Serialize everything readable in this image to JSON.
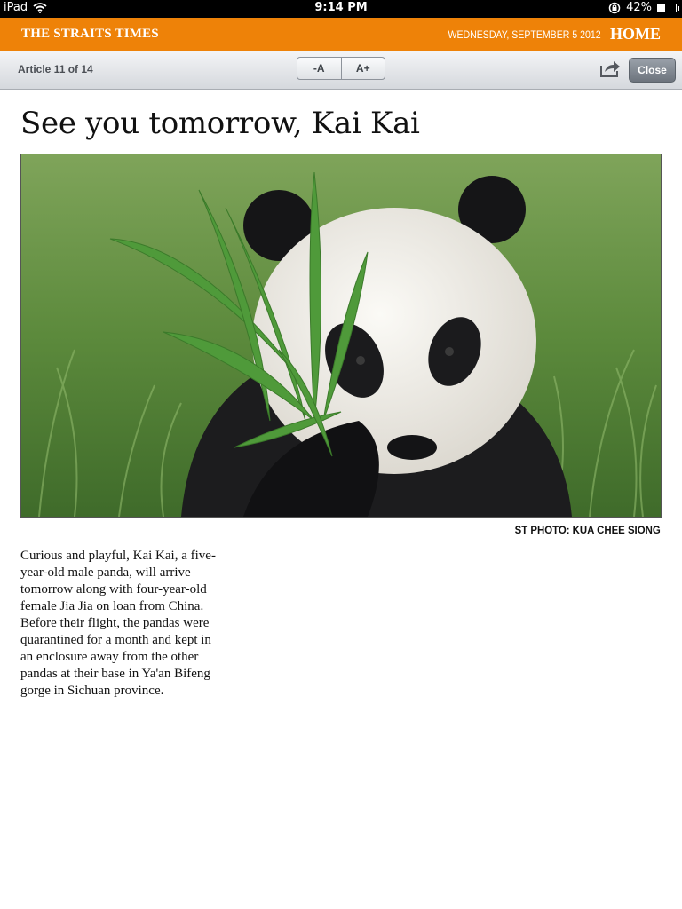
{
  "status_bar": {
    "device": "iPad",
    "time": "9:14 PM",
    "battery": "42%",
    "battery_level": 0.42
  },
  "masthead": {
    "brand": "THE STRAITS TIMES",
    "date": "WEDNESDAY, SEPTEMBER 5 2012",
    "home": "HOME",
    "accent_color": "#ee8208"
  },
  "toolbar": {
    "article_count": "Article 11 of 14",
    "font_decrease": "-A",
    "font_increase": "A+",
    "close_label": "Close"
  },
  "article": {
    "headline": "See you tomorrow, Kai Kai",
    "photo_credit": "ST PHOTO: KUA CHEE SIONG",
    "body": "Curious and playful, Kai Kai, a five-year-old male panda, will arrive tomorrow along with four-year-old female Jia Jia on loan from China. Before their flight, the pandas were quarantined for a month and kept in an enclosure away from the other pandas at their base in Ya'an Bifeng gorge in Sichuan province."
  },
  "icons": {
    "wifi": "wifi-icon",
    "lock": "rotation-lock-icon",
    "battery": "battery-icon",
    "share": "share-icon"
  }
}
